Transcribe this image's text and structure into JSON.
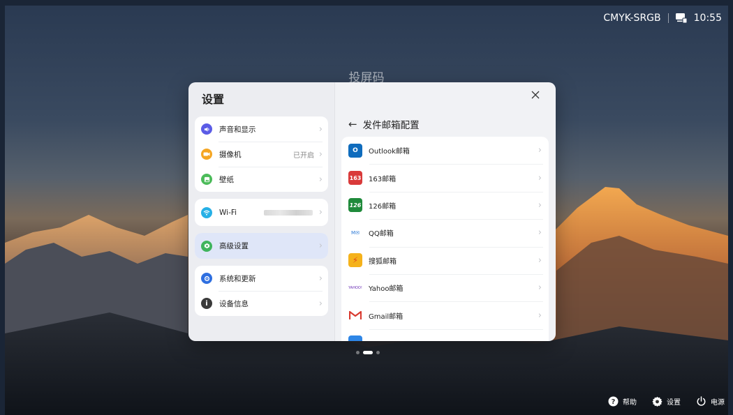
{
  "status": {
    "display_name": "CMYK-SRGB",
    "time": "10:55",
    "cast_icon": "screen-cast-icon"
  },
  "screen_code_label": "投屏码",
  "dialog": {
    "title": "设置",
    "groups": [
      [
        {
          "label": "声音和显示",
          "icon": "sound-icon",
          "color": "#5b5ce6"
        },
        {
          "label": "摄像机",
          "icon": "camera-icon",
          "color": "#f5a623",
          "value": "已开启"
        },
        {
          "label": "壁纸",
          "icon": "wallpaper-icon",
          "color": "#4cbb5a"
        }
      ],
      [
        {
          "label": "Wi-Fi",
          "icon": "wifi-icon",
          "color": "#27b0e6"
        }
      ],
      [
        {
          "label": "高级设置",
          "icon": "advanced-settings-icon",
          "color": "#3fb45d",
          "selected": true
        }
      ],
      [
        {
          "label": "系统和更新",
          "icon": "system-update-icon",
          "color": "#2f6fe0"
        },
        {
          "label": "设备信息",
          "icon": "info-icon",
          "color": "#3a3a3a"
        }
      ]
    ],
    "right": {
      "header": "发件邮箱配置",
      "mail_items": [
        {
          "label": "Outlook邮箱",
          "icon": "outlook-icon",
          "badge": "O",
          "color": "#0f6cbd"
        },
        {
          "label": "163邮箱",
          "icon": "mail-163-icon",
          "badge": "163",
          "color": "#d93a3a"
        },
        {
          "label": "126邮箱",
          "icon": "mail-126-icon",
          "badge": "126",
          "color": "#1f8a3b"
        },
        {
          "label": "QQ邮箱",
          "icon": "qq-mail-icon",
          "badge": "M",
          "color": "#ffffff"
        },
        {
          "label": "搜狐邮箱",
          "icon": "sohu-mail-icon",
          "badge": "⚡",
          "color": "#f5b21b"
        },
        {
          "label": "Yahoo邮箱",
          "icon": "yahoo-mail-icon",
          "badge": "Y!",
          "color": "#ffffff"
        },
        {
          "label": "Gmail邮箱",
          "icon": "gmail-icon",
          "badge": "M",
          "color": "#ffffff"
        },
        {
          "label": "",
          "icon": "more-mail-icon",
          "badge": "",
          "color": "#2e86e6"
        }
      ]
    }
  },
  "bottom": {
    "help": "帮助",
    "settings": "设置",
    "power": "电源"
  }
}
